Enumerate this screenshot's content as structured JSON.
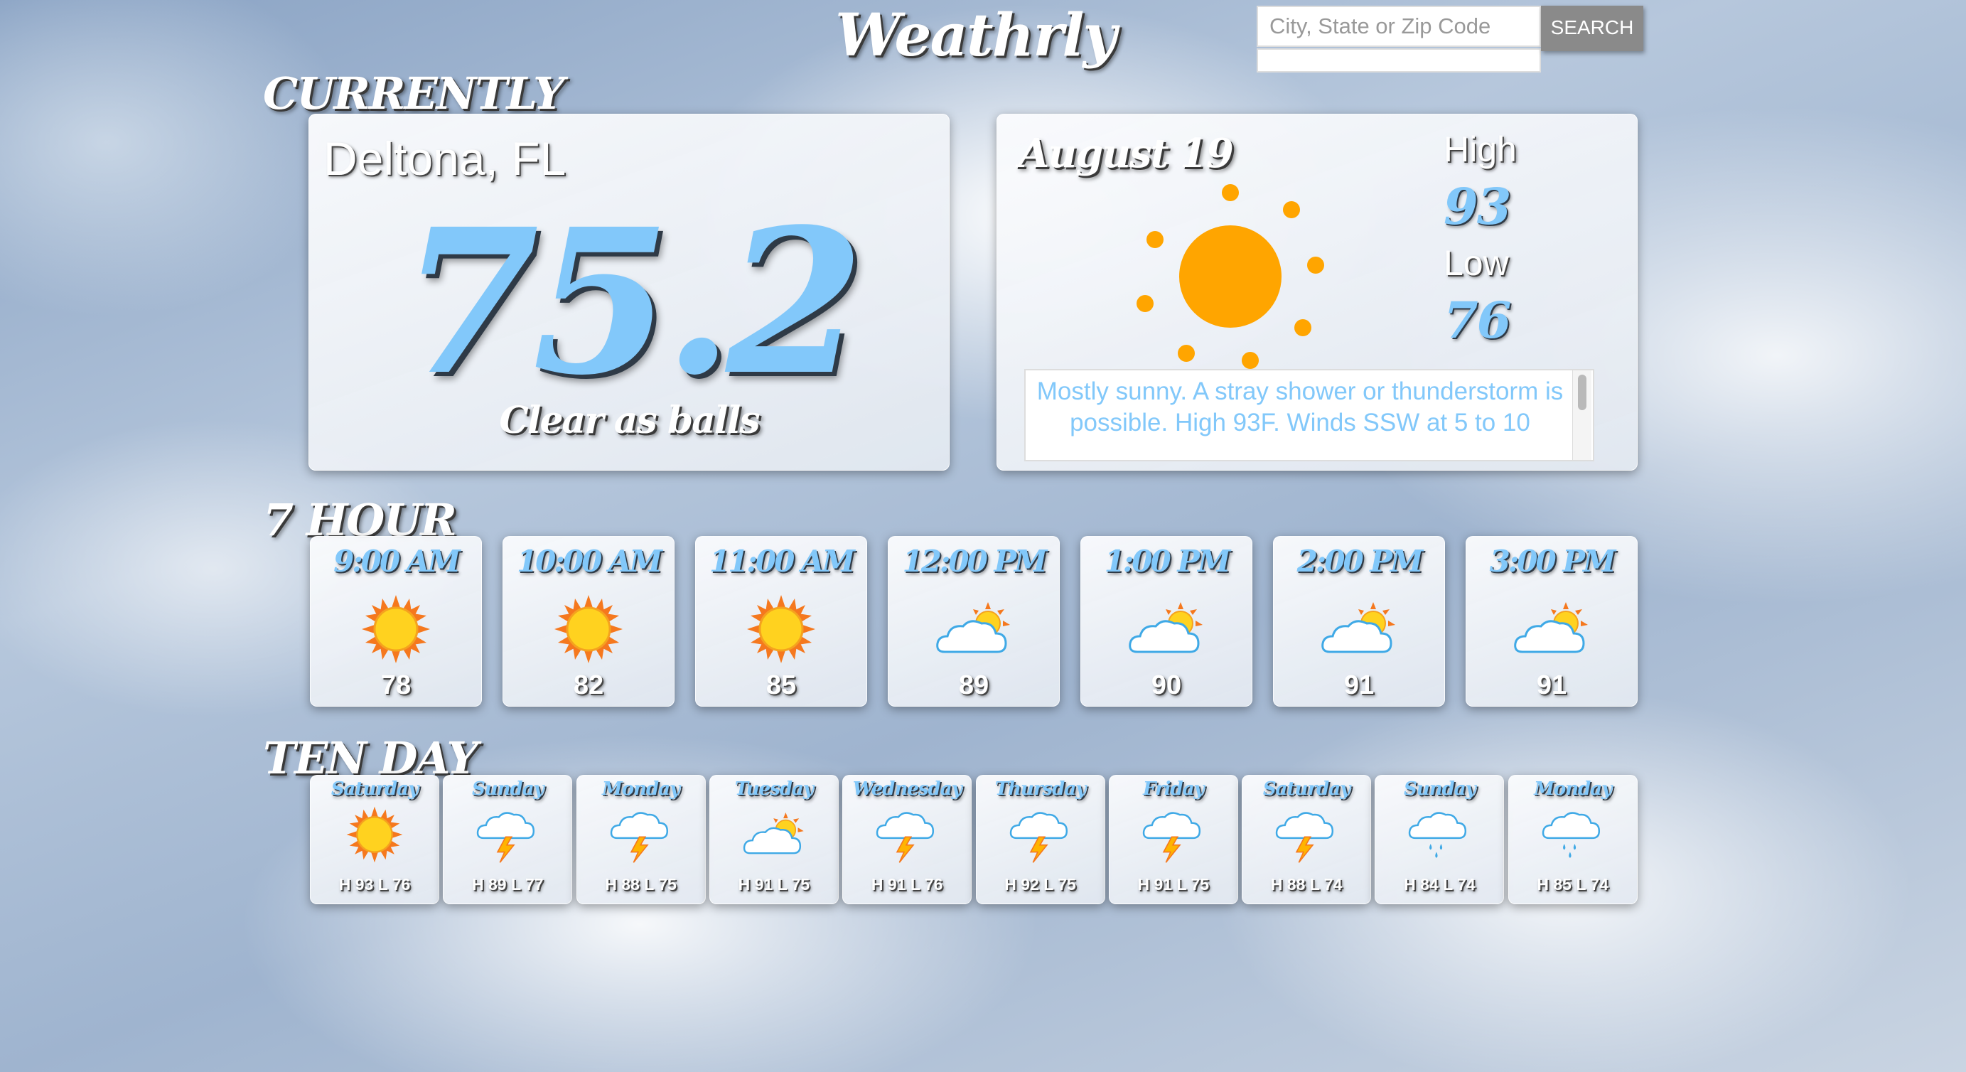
{
  "app": {
    "title": "Weathrly"
  },
  "search": {
    "placeholder": "City, State or Zip Code",
    "button_label": "SEARCH"
  },
  "sections": {
    "currently": "CURRENTLY",
    "hourly": "7 HOUR",
    "ten_day": "TEN DAY"
  },
  "current": {
    "location": "Deltona, FL",
    "temperature": "75.2",
    "condition": "Clear as balls"
  },
  "today": {
    "date": "August 19",
    "high_label": "High",
    "high": "93",
    "low_label": "Low",
    "low": "76",
    "description": "Mostly sunny. A stray shower or thunderstorm is possible. High 93F. Winds SSW at 5 to 10",
    "icon": "sun-icon"
  },
  "hourly": [
    {
      "time": "9:00 AM",
      "temp": "78",
      "icon": "sun-icon"
    },
    {
      "time": "10:00 AM",
      "temp": "82",
      "icon": "sun-icon"
    },
    {
      "time": "11:00 AM",
      "temp": "85",
      "icon": "sun-icon"
    },
    {
      "time": "12:00 PM",
      "temp": "89",
      "icon": "partly-cloudy-icon"
    },
    {
      "time": "1:00 PM",
      "temp": "90",
      "icon": "partly-cloudy-icon"
    },
    {
      "time": "2:00 PM",
      "temp": "91",
      "icon": "partly-cloudy-icon"
    },
    {
      "time": "3:00 PM",
      "temp": "91",
      "icon": "partly-cloudy-icon"
    }
  ],
  "ten_day": [
    {
      "day": "Saturday",
      "hl": "H 93 L 76",
      "icon": "sun-icon"
    },
    {
      "day": "Sunday",
      "hl": "H 89 L 77",
      "icon": "thunderstorm-icon"
    },
    {
      "day": "Monday",
      "hl": "H 88 L 75",
      "icon": "thunderstorm-icon"
    },
    {
      "day": "Tuesday",
      "hl": "H 91 L 75",
      "icon": "partly-cloudy-icon"
    },
    {
      "day": "Wednesday",
      "hl": "H 91 L 76",
      "icon": "thunderstorm-icon"
    },
    {
      "day": "Thursday",
      "hl": "H 92 L 75",
      "icon": "thunderstorm-icon"
    },
    {
      "day": "Friday",
      "hl": "H 91 L 75",
      "icon": "thunderstorm-icon"
    },
    {
      "day": "Saturday",
      "hl": "H 88 L 74",
      "icon": "thunderstorm-icon"
    },
    {
      "day": "Sunday",
      "hl": "H 84 L 74",
      "icon": "rain-icon"
    },
    {
      "day": "Monday",
      "hl": "H 85 L 74",
      "icon": "rain-icon"
    }
  ],
  "colors": {
    "accent": "#82c8fa",
    "sun": "#ffa500",
    "search_button": "#8a8a8a"
  }
}
